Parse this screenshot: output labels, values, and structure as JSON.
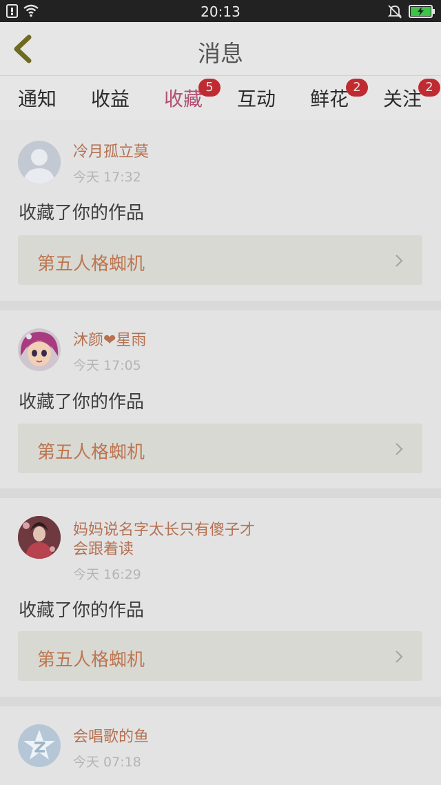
{
  "status_bar": {
    "time": "20:13",
    "left_icons": [
      "sim-icon",
      "wifi-icon"
    ],
    "right_icons": [
      "bell-mute-icon",
      "battery-charging-icon"
    ],
    "battery_color": "#3fc34a"
  },
  "header": {
    "title": "消息",
    "back_icon": "chevron-left-icon",
    "back_color": "#6e6a1f"
  },
  "tabs": [
    {
      "label": "通知",
      "badge": ""
    },
    {
      "label": "收益",
      "badge": ""
    },
    {
      "label": "收藏",
      "badge": "5",
      "active": true
    },
    {
      "label": "互动",
      "badge": ""
    },
    {
      "label": "鲜花",
      "badge": "2"
    },
    {
      "label": "关注",
      "badge": "2"
    }
  ],
  "feed": [
    {
      "user": "冷月孤立莫",
      "time": "今天 17:32",
      "action": "收藏了你的作品",
      "work": "第五人格蜘机",
      "avatar": "default-avatar-icon"
    },
    {
      "user": "沐颜❤星雨",
      "time": "今天 17:05",
      "action": "收藏了你的作品",
      "work": "第五人格蜘机",
      "avatar": "cartoon-girl-avatar"
    },
    {
      "user_line1": "妈妈说名字太长只有傻子才",
      "user_line2": "会跟着读",
      "time": "今天 16:29",
      "action": "收藏了你的作品",
      "work": "第五人格蜘机",
      "avatar": "costume-photo-avatar"
    },
    {
      "user": "会唱歌的鱼",
      "time": "今天 07:18",
      "avatar": "qzone-star-avatar"
    }
  ],
  "colors": {
    "accent": "#b24f72",
    "badge": "#bf2b31",
    "username": "#b57152",
    "work_title": "#bd7650"
  }
}
